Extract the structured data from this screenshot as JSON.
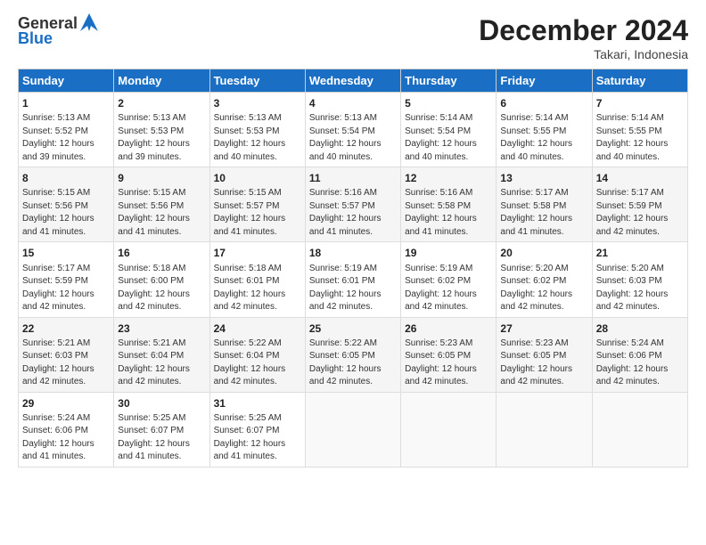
{
  "header": {
    "logo_line1": "General",
    "logo_line2": "Blue",
    "month_title": "December 2024",
    "location": "Takari, Indonesia"
  },
  "calendar": {
    "weekdays": [
      "Sunday",
      "Monday",
      "Tuesday",
      "Wednesday",
      "Thursday",
      "Friday",
      "Saturday"
    ],
    "weeks": [
      [
        {
          "day": "1",
          "sunrise": "5:13 AM",
          "sunset": "5:52 PM",
          "daylight": "12 hours and 39 minutes."
        },
        {
          "day": "2",
          "sunrise": "5:13 AM",
          "sunset": "5:53 PM",
          "daylight": "12 hours and 39 minutes."
        },
        {
          "day": "3",
          "sunrise": "5:13 AM",
          "sunset": "5:53 PM",
          "daylight": "12 hours and 40 minutes."
        },
        {
          "day": "4",
          "sunrise": "5:13 AM",
          "sunset": "5:54 PM",
          "daylight": "12 hours and 40 minutes."
        },
        {
          "day": "5",
          "sunrise": "5:14 AM",
          "sunset": "5:54 PM",
          "daylight": "12 hours and 40 minutes."
        },
        {
          "day": "6",
          "sunrise": "5:14 AM",
          "sunset": "5:55 PM",
          "daylight": "12 hours and 40 minutes."
        },
        {
          "day": "7",
          "sunrise": "5:14 AM",
          "sunset": "5:55 PM",
          "daylight": "12 hours and 40 minutes."
        }
      ],
      [
        {
          "day": "8",
          "sunrise": "5:15 AM",
          "sunset": "5:56 PM",
          "daylight": "12 hours and 41 minutes."
        },
        {
          "day": "9",
          "sunrise": "5:15 AM",
          "sunset": "5:56 PM",
          "daylight": "12 hours and 41 minutes."
        },
        {
          "day": "10",
          "sunrise": "5:15 AM",
          "sunset": "5:57 PM",
          "daylight": "12 hours and 41 minutes."
        },
        {
          "day": "11",
          "sunrise": "5:16 AM",
          "sunset": "5:57 PM",
          "daylight": "12 hours and 41 minutes."
        },
        {
          "day": "12",
          "sunrise": "5:16 AM",
          "sunset": "5:58 PM",
          "daylight": "12 hours and 41 minutes."
        },
        {
          "day": "13",
          "sunrise": "5:17 AM",
          "sunset": "5:58 PM",
          "daylight": "12 hours and 41 minutes."
        },
        {
          "day": "14",
          "sunrise": "5:17 AM",
          "sunset": "5:59 PM",
          "daylight": "12 hours and 42 minutes."
        }
      ],
      [
        {
          "day": "15",
          "sunrise": "5:17 AM",
          "sunset": "5:59 PM",
          "daylight": "12 hours and 42 minutes."
        },
        {
          "day": "16",
          "sunrise": "5:18 AM",
          "sunset": "6:00 PM",
          "daylight": "12 hours and 42 minutes."
        },
        {
          "day": "17",
          "sunrise": "5:18 AM",
          "sunset": "6:01 PM",
          "daylight": "12 hours and 42 minutes."
        },
        {
          "day": "18",
          "sunrise": "5:19 AM",
          "sunset": "6:01 PM",
          "daylight": "12 hours and 42 minutes."
        },
        {
          "day": "19",
          "sunrise": "5:19 AM",
          "sunset": "6:02 PM",
          "daylight": "12 hours and 42 minutes."
        },
        {
          "day": "20",
          "sunrise": "5:20 AM",
          "sunset": "6:02 PM",
          "daylight": "12 hours and 42 minutes."
        },
        {
          "day": "21",
          "sunrise": "5:20 AM",
          "sunset": "6:03 PM",
          "daylight": "12 hours and 42 minutes."
        }
      ],
      [
        {
          "day": "22",
          "sunrise": "5:21 AM",
          "sunset": "6:03 PM",
          "daylight": "12 hours and 42 minutes."
        },
        {
          "day": "23",
          "sunrise": "5:21 AM",
          "sunset": "6:04 PM",
          "daylight": "12 hours and 42 minutes."
        },
        {
          "day": "24",
          "sunrise": "5:22 AM",
          "sunset": "6:04 PM",
          "daylight": "12 hours and 42 minutes."
        },
        {
          "day": "25",
          "sunrise": "5:22 AM",
          "sunset": "6:05 PM",
          "daylight": "12 hours and 42 minutes."
        },
        {
          "day": "26",
          "sunrise": "5:23 AM",
          "sunset": "6:05 PM",
          "daylight": "12 hours and 42 minutes."
        },
        {
          "day": "27",
          "sunrise": "5:23 AM",
          "sunset": "6:05 PM",
          "daylight": "12 hours and 42 minutes."
        },
        {
          "day": "28",
          "sunrise": "5:24 AM",
          "sunset": "6:06 PM",
          "daylight": "12 hours and 42 minutes."
        }
      ],
      [
        {
          "day": "29",
          "sunrise": "5:24 AM",
          "sunset": "6:06 PM",
          "daylight": "12 hours and 41 minutes."
        },
        {
          "day": "30",
          "sunrise": "5:25 AM",
          "sunset": "6:07 PM",
          "daylight": "12 hours and 41 minutes."
        },
        {
          "day": "31",
          "sunrise": "5:25 AM",
          "sunset": "6:07 PM",
          "daylight": "12 hours and 41 minutes."
        },
        null,
        null,
        null,
        null
      ]
    ]
  }
}
